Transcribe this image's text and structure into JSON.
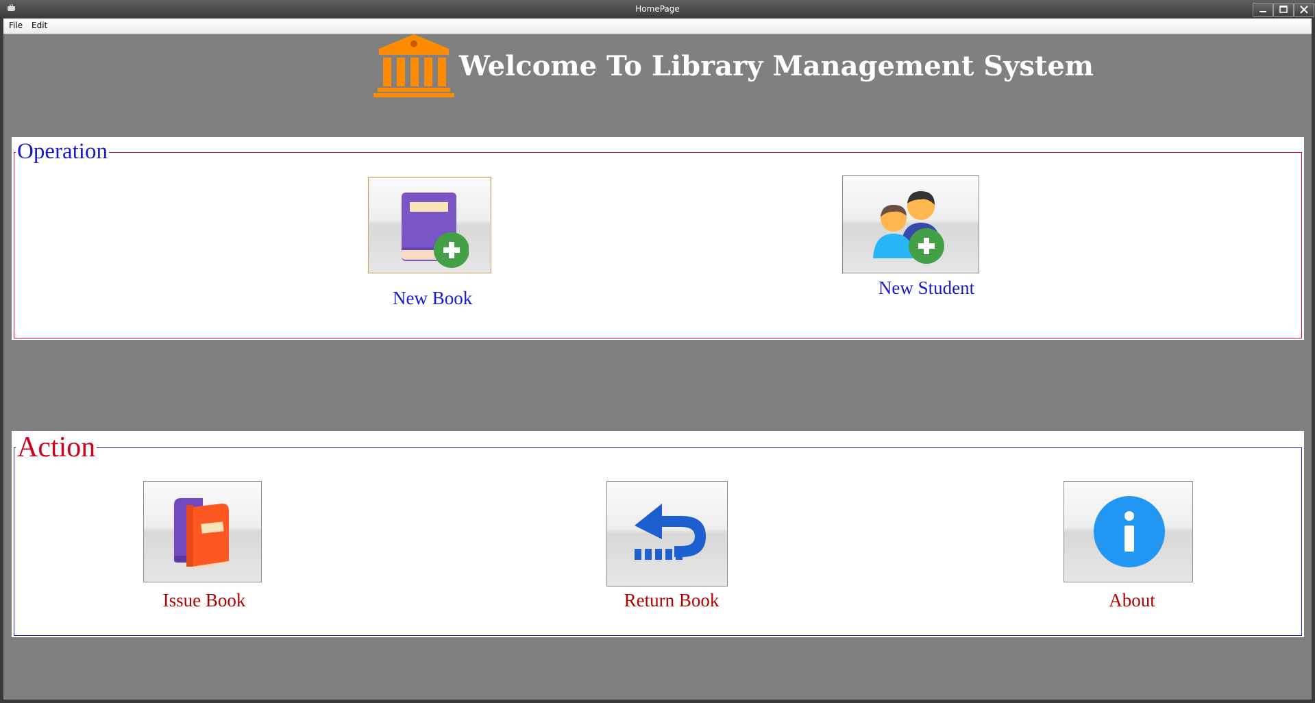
{
  "window": {
    "title": "HomePage"
  },
  "menu": {
    "items": [
      "File",
      "Edit"
    ]
  },
  "header": {
    "title": "Welcome To Library Management System"
  },
  "operation": {
    "legend": "Operation",
    "new_book_label": "New Book",
    "new_student_label": "New Student"
  },
  "action": {
    "legend": "Action",
    "issue_book_label": "Issue Book",
    "return_book_label": "Return Book",
    "about_label": "About"
  },
  "icons": {
    "logo": "library-building-icon",
    "new_book": "book-add-icon",
    "new_student": "students-add-icon",
    "issue_book": "books-icon",
    "return_book": "return-arrow-icon",
    "about": "info-icon"
  },
  "colors": {
    "background": "#808080",
    "operation_text": "#1a1acc",
    "action_text": "#b00000",
    "operation_border": "#c8102e",
    "action_border": "#1f2a8a",
    "logo": "#ff8c00"
  }
}
